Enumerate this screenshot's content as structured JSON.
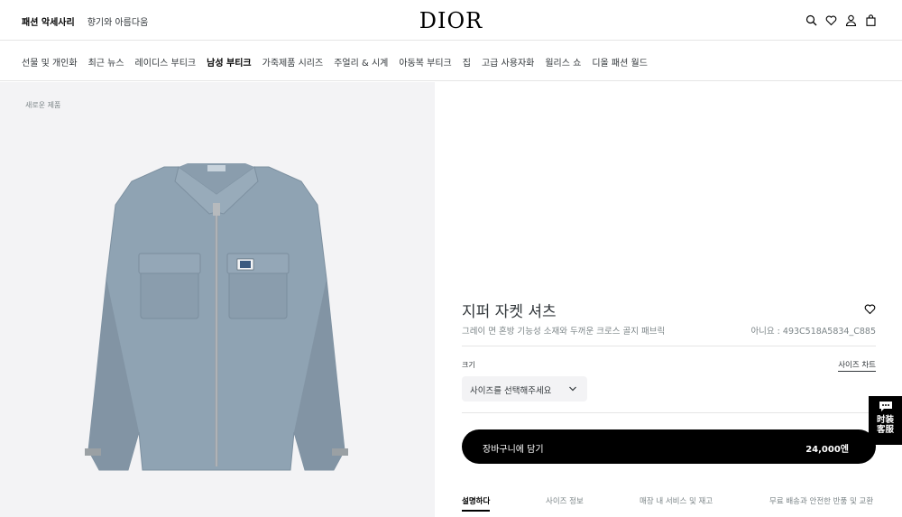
{
  "header": {
    "top_links": [
      "패션 악세사리",
      "향기와 아름다움"
    ],
    "logo": "DIOR",
    "icons": [
      "search-icon",
      "heart-icon",
      "user-icon",
      "bag-icon"
    ]
  },
  "nav": {
    "items": [
      "선물 및 개인화",
      "최근 뉴스",
      "레이디스 부티크",
      "남성 부티크",
      "가죽제품 시리즈",
      "주얼리 & 시계",
      "아동복 부티크",
      "집",
      "고급 사용자화",
      "윌리스 쇼",
      "디올 패션 월드"
    ]
  },
  "gallery": {
    "tag": "새로운 제품"
  },
  "product": {
    "title": "지퍼 자켓 셔츠",
    "subtitle": "그레이 면 혼방 기능성 소재와 두꺼운 크로스 골지 패브릭",
    "reference": "아니요 : 493C518A5834_C885",
    "size_label": "크기",
    "size_chart": "사이즈 차트",
    "size_select": "사이즈를 선택해주세요",
    "cart_label": "장바구니에 담기",
    "price": "24,000엔",
    "tabs": [
      "설명하다",
      "사이즈 정보",
      "매장 내 서비스 및 재고",
      "무료 배송과 안전한 반품 및 교환"
    ]
  },
  "chat": {
    "line1": "时装",
    "line2": "客服"
  },
  "colors": {
    "accent": "#000000",
    "text": "#33383c",
    "muted": "#7b8487",
    "gallery_bg": "#f3f3f5",
    "jacket": "#8fa3b3"
  }
}
